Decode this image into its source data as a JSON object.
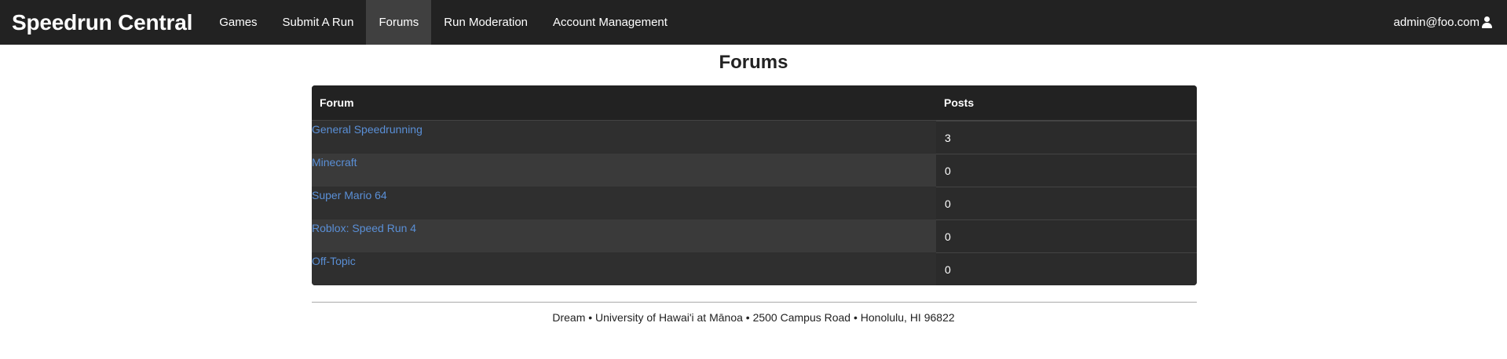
{
  "navbar": {
    "brand": "Speedrun Central",
    "items": [
      {
        "label": "Games",
        "active": false
      },
      {
        "label": "Submit A Run",
        "active": false
      },
      {
        "label": "Forums",
        "active": true
      },
      {
        "label": "Run Moderation",
        "active": false
      },
      {
        "label": "Account Management",
        "active": false
      }
    ],
    "user": {
      "email": "admin@foo.com",
      "icon": "user-icon"
    }
  },
  "page": {
    "title": "Forums"
  },
  "table": {
    "headers": {
      "forum": "Forum",
      "posts": "Posts"
    },
    "rows": [
      {
        "forum": "General Speedrunning",
        "posts": "3"
      },
      {
        "forum": "Minecraft",
        "posts": "0"
      },
      {
        "forum": "Super Mario 64",
        "posts": "0"
      },
      {
        "forum": "Roblox: Speed Run 4",
        "posts": "0"
      },
      {
        "forum": "Off-Topic",
        "posts": "0"
      }
    ]
  },
  "footer": {
    "text": "Dream • University of Hawai'i at Mānoa • 2500 Campus Road • Honolulu, HI 96822"
  },
  "colors": {
    "navbar_bg": "#222222",
    "nav_active_bg": "#404040",
    "table_bg": "#2f2f2f",
    "link": "#5a8fd6"
  }
}
